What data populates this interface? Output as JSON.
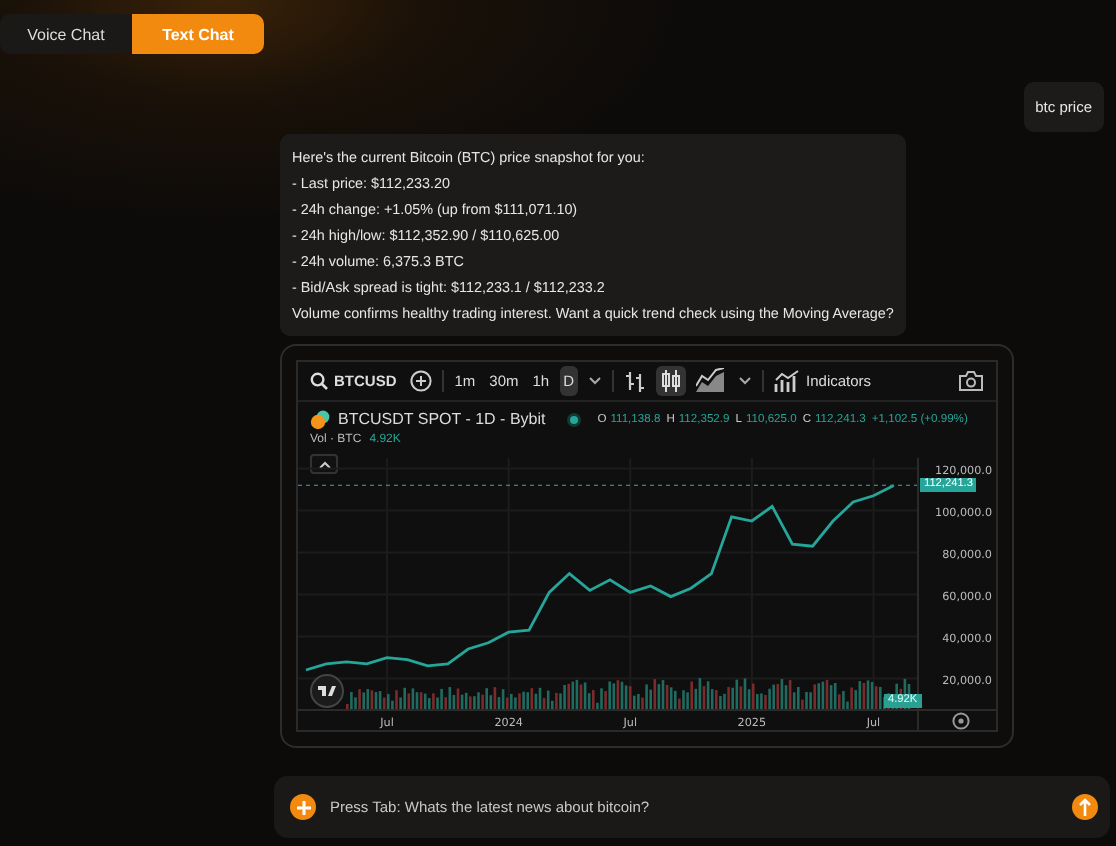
{
  "mode_tabs": [
    {
      "label": "Voice Chat",
      "selected": false
    },
    {
      "label": "Text Chat",
      "selected": true
    }
  ],
  "messages": [
    {
      "kind": "user",
      "lines": [
        "btc price"
      ]
    },
    {
      "kind": "assistant",
      "lines": [
        "Here's the current Bitcoin (BTC) price snapshot for you:",
        "- Last price: $112,233.20",
        "- 24h change: +1.05% (up from $111,071.10)",
        "- 24h high/low: $112,352.90 / $110,625.00",
        "- 24h volume: 6,375.3 BTC",
        "- Bid/Ask spread is tight: $112,233.1 / $112,233.2",
        "Volume confirms healthy trading interest. Want a quick trend check using the Moving Average?"
      ]
    }
  ],
  "chart_widget": {
    "symbol": "BTCUSD",
    "intervals": [
      {
        "label": "1m",
        "selected": false
      },
      {
        "label": "30m",
        "selected": false
      },
      {
        "label": "1h",
        "selected": false
      },
      {
        "label": "D",
        "selected": true
      }
    ],
    "chart_styles": [
      {
        "kind": "bars",
        "selected": false
      },
      {
        "kind": "candles",
        "selected": true
      },
      {
        "kind": "area",
        "selected": false
      }
    ],
    "indicators_label": "Indicators",
    "title": "BTCUSDT SPOT - 1D - Bybit",
    "ohlc": [
      {
        "key": "O",
        "value": "111,138.8"
      },
      {
        "key": "H",
        "value": "112,352.9"
      },
      {
        "key": "L",
        "value": "110,625.0"
      },
      {
        "key": "C",
        "value": "112,241.3"
      }
    ],
    "change": "+1,102.5 (+0.99%)",
    "volume_label": "Vol · BTC",
    "volume_value": "4.92K",
    "volume_tag": "4.92K",
    "last_price_tag": "112,241.3",
    "chart_data": {
      "type": "line",
      "categories": [
        null,
        null,
        null,
        null,
        "Jul",
        null,
        null,
        null,
        null,
        null,
        "2024",
        null,
        null,
        null,
        null,
        null,
        "Jul",
        null,
        null,
        null,
        null,
        null,
        "2025",
        null,
        null,
        null,
        null,
        null,
        "Jul",
        null
      ],
      "series": [
        {
          "color": "#26a69a",
          "values": [
            24000,
            27000,
            28000,
            27000,
            30000,
            29000,
            26000,
            27000,
            34000,
            37000,
            42000,
            43000,
            61000,
            70000,
            62000,
            67000,
            61000,
            64000,
            59000,
            63000,
            70000,
            97000,
            95000,
            102000,
            84000,
            83000,
            95000,
            104000,
            107000,
            112000
          ]
        }
      ],
      "ylim": [
        5000,
        125000
      ],
      "grid": true,
      "yticks": [
        {
          "value": 120000,
          "label": "120,000.0"
        },
        {
          "value": 100000,
          "label": "100,000.0"
        },
        {
          "value": 80000,
          "label": "80,000.0"
        },
        {
          "value": 60000,
          "label": "60,000.0"
        },
        {
          "value": 40000,
          "label": "40,000.0"
        },
        {
          "value": 20000,
          "label": "20,000.0"
        }
      ]
    }
  },
  "composer": {
    "placeholder": "Press Tab: Whats the latest news about bitcoin?"
  }
}
